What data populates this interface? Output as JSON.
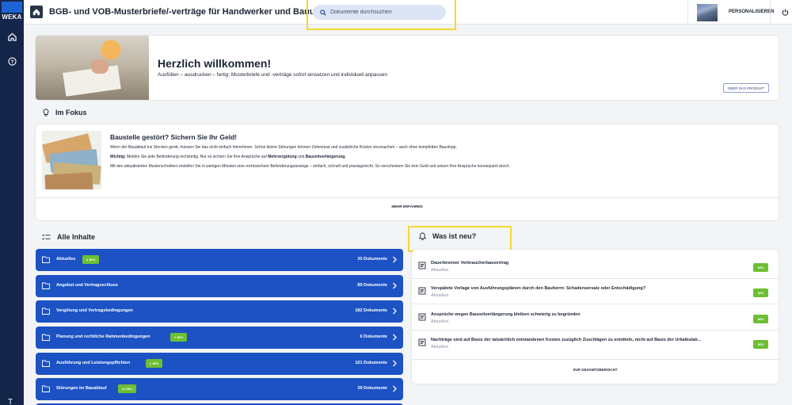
{
  "rail": {
    "logo": "WEKA",
    "bottom_glyph": "T"
  },
  "topbar": {
    "title": "BGB- und VOB-Musterbriefe/-verträge für Handwerker und Bauunternehmer",
    "search_placeholder": "Dokumente durchsuchen",
    "personalize_label": "PERSONALISIEREN"
  },
  "welcome": {
    "title": "Herzlich willkommen!",
    "subtitle": "Ausfüllen – ausdrucken – fertig: Musterbriefe und -verträge sofort einsetzen und individuell anpassen",
    "about_button": "ÜBER DAS PRODUKT"
  },
  "focus": {
    "section_title": "Im Fokus",
    "card_title": "Baustelle gestört? Sichern Sie Ihr Geld!",
    "line1": "Wenn der Bauablauf ins Stocken gerät, müssen Sie das nicht einfach hinnehmen. Schon kleine Störungen können Zeitverlust und zusätzliche Kosten verursachen – auch ohne kompletten Baustopp.",
    "line2_bold": "Wichtig:",
    "line2_a": " Melden Sie jede Behinderung rechtzeitig. Nur so sichern Sie Ihre Ansprüche auf ",
    "line2_b1": "Mehrvergütung",
    "line2_and": " und ",
    "line2_b2": "Bauzeitverlängerung.",
    "line3": "Mit den aktualisierten Musterschreiben erstellen Sie in wenigen Minuten eine rechtssichere Behinderungsanzeige – einfach, schnell und praxisgerecht. So verschenken Sie kein Geld und setzen Ihre Ansprüche konsequent durch.",
    "more_button": "MEHR ERFAHREN"
  },
  "all_contents": {
    "section_title": "Alle Inhalte",
    "rows": [
      {
        "label": "Aktuelles",
        "badge": "4 NEU",
        "count": "30 Dokumente"
      },
      {
        "label": "Angebot und Vertragsschluss",
        "badge": "",
        "count": "89 Dokumente"
      },
      {
        "label": "Vergütung und Vertragsbedingungen",
        "badge": "",
        "count": "182 Dokumente"
      },
      {
        "label": "Planung und rechtliche Rahmenbedingungen",
        "badge": "1 NEU",
        "count": "6 Dokumente"
      },
      {
        "label": "Ausführung und Leistungspflichten",
        "badge": "1 NEU",
        "count": "101 Dokumente"
      },
      {
        "label": "Störungen im Bauablauf",
        "badge": "11 NEU",
        "count": "39 Dokumente"
      }
    ]
  },
  "whats_new": {
    "section_title": "Was ist neu?",
    "items": [
      {
        "title": "Dauerbrenner Verbraucherbauvertrag",
        "category": "Aktuelles",
        "badge": "NEU"
      },
      {
        "title": "Verspätete Vorlage von Ausführungsplänen durch den Bauherrn: Schadensersatz oder Entschädigung?",
        "category": "Aktuelles",
        "badge": "NEU"
      },
      {
        "title": "Ansprüche wegen Bauzeitverlängerung bleiben schwierig zu begründen",
        "category": "Aktuelles",
        "badge": "NEU"
      },
      {
        "title": "Nachträge sind auf Basis der tatsächlich entstandenen Kosten zuzüglich Zuschlägen zu ermitteln, nicht auf Basis der Urkalkulati...",
        "category": "Aktuelles",
        "badge": "NEU"
      }
    ],
    "overview_button": "ZUR GESAMTÜBERSICHT"
  },
  "colors": {
    "rail": "#14254a",
    "primary_blue": "#1c52c4",
    "badge_green": "#6dbf33",
    "highlight_yellow": "#f3d835",
    "search_bg": "#dbe5f5"
  }
}
